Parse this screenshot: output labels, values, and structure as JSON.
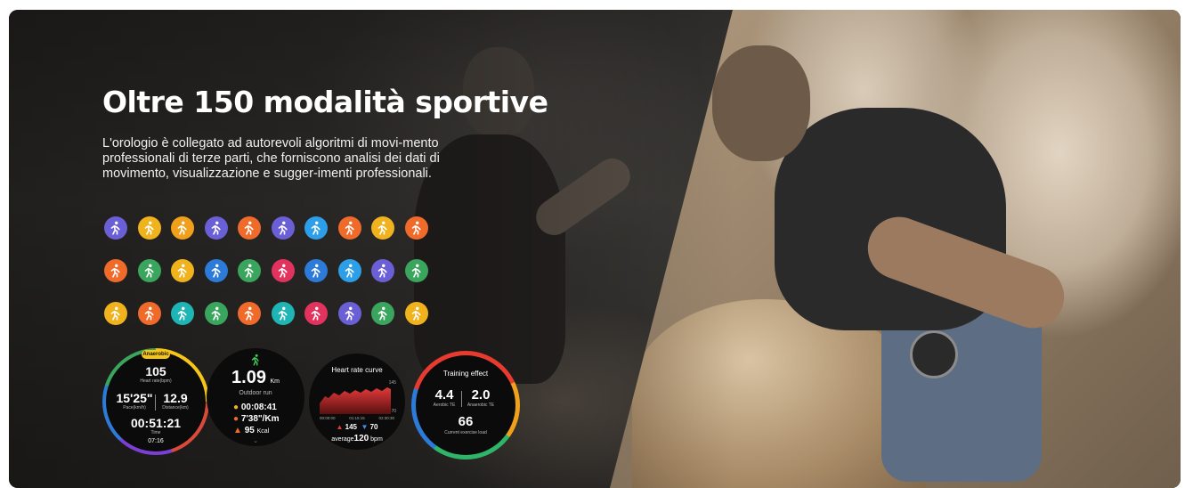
{
  "hero": {
    "title": "Oltre 150 modalità sportive",
    "description": "L'orologio è collegato ad autorevoli algoritmi di movi-mento professionali di terze parti, che forniscono analisi dei dati di movimento, visualizzazione e sugger-imenti professionali."
  },
  "sport_icons": [
    [
      {
        "name": "stepper-icon",
        "color": "#6b5fd6"
      },
      {
        "name": "walking-icon",
        "color": "#f0b21d"
      },
      {
        "name": "triathlon-icon",
        "color": "#f0a01a"
      },
      {
        "name": "jump-rope-icon",
        "color": "#6b5fd6"
      },
      {
        "name": "martial-arts-icon",
        "color": "#f06a2a"
      },
      {
        "name": "hiking-icon",
        "color": "#6b5fd6"
      },
      {
        "name": "cycling-icon",
        "color": "#2d9ee8"
      },
      {
        "name": "running-icon",
        "color": "#f06a2a"
      },
      {
        "name": "dance-icon",
        "color": "#f0b21d"
      },
      {
        "name": "sprint-icon",
        "color": "#f06a2a"
      }
    ],
    [
      {
        "name": "rowing-icon",
        "color": "#f06a2a"
      },
      {
        "name": "skating-icon",
        "color": "#3aa55d"
      },
      {
        "name": "climbing-icon",
        "color": "#f0b21d"
      },
      {
        "name": "swimming-icon",
        "color": "#2d7bd8"
      },
      {
        "name": "aerobics-icon",
        "color": "#3aa55d"
      },
      {
        "name": "gymnastics-icon",
        "color": "#e2335e"
      },
      {
        "name": "skiing-icon",
        "color": "#2d7bd8"
      },
      {
        "name": "snowboard-icon",
        "color": "#2d9ee8"
      },
      {
        "name": "nordic-walk-icon",
        "color": "#6b5fd6"
      },
      {
        "name": "trail-run-icon",
        "color": "#3aa55d"
      }
    ],
    [
      {
        "name": "bike-icon",
        "color": "#f0b21d"
      },
      {
        "name": "mountaineering-icon",
        "color": "#f06a2a"
      },
      {
        "name": "parkour-icon",
        "color": "#1fb5b5"
      },
      {
        "name": "fitness-icon",
        "color": "#3aa55d"
      },
      {
        "name": "walk-icon",
        "color": "#f06a2a"
      },
      {
        "name": "yoga-icon",
        "color": "#1fb5b5"
      },
      {
        "name": "ballet-icon",
        "color": "#e2335e"
      },
      {
        "name": "treadmill-icon",
        "color": "#6b5fd6"
      },
      {
        "name": "elliptical-icon",
        "color": "#3aa55d"
      },
      {
        "name": "strength-icon",
        "color": "#f0b21d"
      }
    ]
  ],
  "watch_faces": {
    "aerobic": {
      "badge": "Anaerobic",
      "heart_rate": "105",
      "heart_rate_label": "Heart rate(bpm)",
      "pace": "15'25\"",
      "pace_label": "Pace(km/h)",
      "distance": "12.9",
      "distance_label": "Distance(km)",
      "time": "00:51:21",
      "time_label": "Time",
      "clock": "07:16"
    },
    "outdoor_run": {
      "distance": "1.09",
      "unit": "Km",
      "mode": "Outdoor run",
      "duration": "00:08:41",
      "pace": "7'38\"/Km",
      "calories": "95",
      "calories_unit": "Kcal"
    },
    "heart_rate_curve": {
      "title": "Heart rate curve",
      "y_max": "145",
      "y_min": "70",
      "t_start": "00:00:00",
      "t_mid": "01:15:15",
      "t_end": "02:30:30",
      "max": "145",
      "min": "70",
      "average_label": "average",
      "average": "120",
      "average_unit": "bpm"
    },
    "training_effect": {
      "title": "Training effect",
      "aerobic": "4.4",
      "aerobic_label": "Aerobic TE",
      "anaerobic": "2.0",
      "anaerobic_label": "Anaerobic TE",
      "load": "66",
      "load_label": "Current exercise load"
    }
  }
}
